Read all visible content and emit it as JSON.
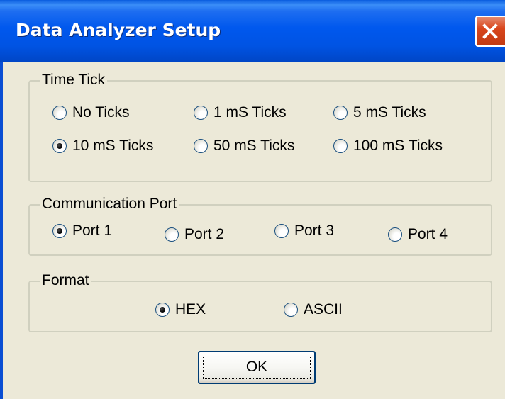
{
  "window": {
    "title": "Data Analyzer Setup",
    "close_icon": "close-x-icon",
    "colors": {
      "titlebar": "#0058ee",
      "close_button": "#d9461d",
      "dialog_background": "#ece9d8"
    }
  },
  "groups": {
    "time_tick": {
      "label": "Time Tick",
      "options": [
        {
          "label": "No Ticks",
          "selected": false
        },
        {
          "label": "1 mS Ticks",
          "selected": false
        },
        {
          "label": "5 mS Ticks",
          "selected": false
        },
        {
          "label": "10 mS Ticks",
          "selected": true
        },
        {
          "label": "50 mS Ticks",
          "selected": false
        },
        {
          "label": "100 mS Ticks",
          "selected": false
        }
      ]
    },
    "comm_port": {
      "label": "Communication Port",
      "options": [
        {
          "label": "Port 1",
          "selected": true
        },
        {
          "label": "Port 2",
          "selected": false
        },
        {
          "label": "Port 3",
          "selected": false
        },
        {
          "label": "Port 4",
          "selected": false
        }
      ]
    },
    "format": {
      "label": "Format",
      "options": [
        {
          "label": "HEX",
          "selected": true
        },
        {
          "label": "ASCII",
          "selected": false
        }
      ]
    }
  },
  "buttons": {
    "ok_label": "OK"
  }
}
